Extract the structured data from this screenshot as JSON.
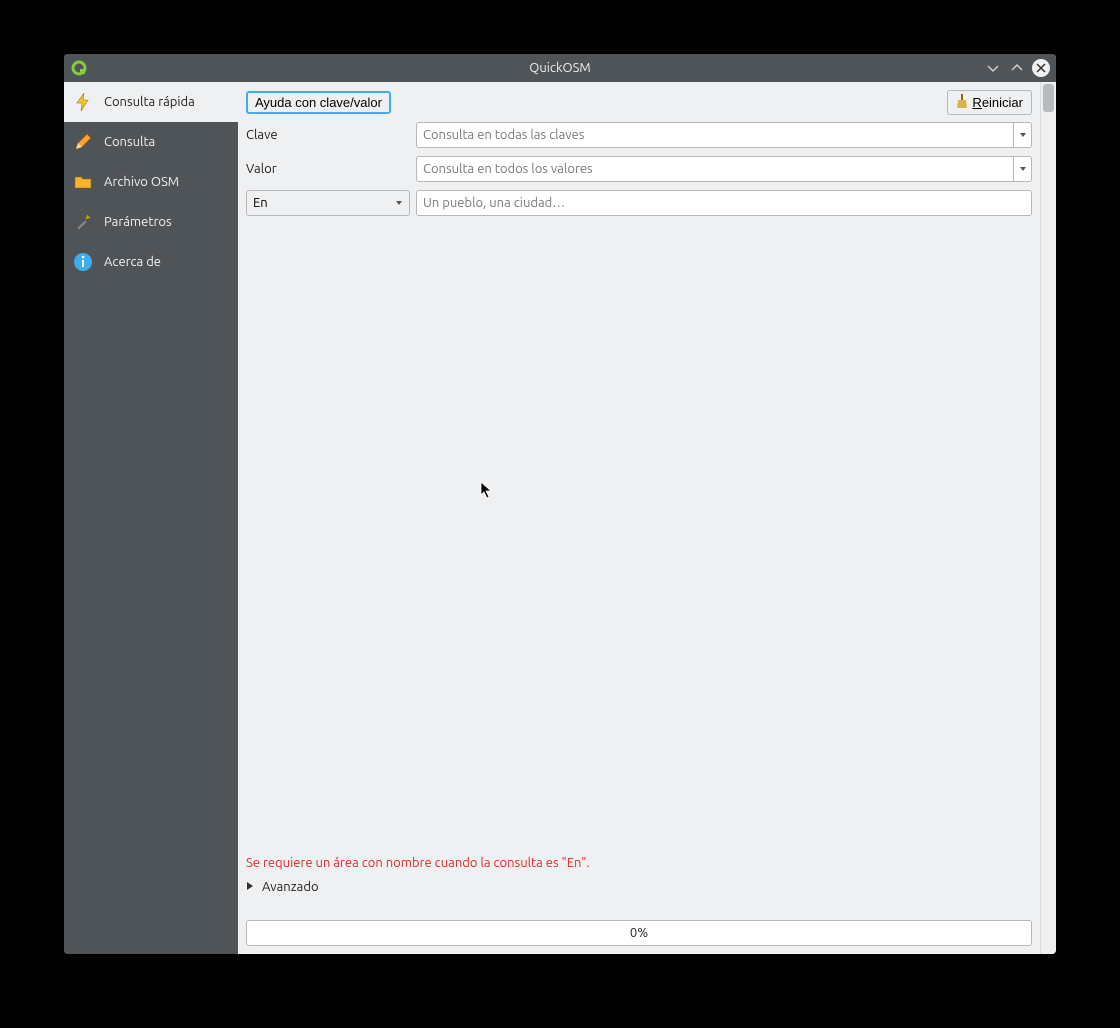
{
  "window": {
    "title": "QuickOSM"
  },
  "sidebar": {
    "items": [
      {
        "label": "Consulta rápida"
      },
      {
        "label": "Consulta"
      },
      {
        "label": "Archivo OSM"
      },
      {
        "label": "Parámetros"
      },
      {
        "label": "Acerca de"
      }
    ]
  },
  "toolbar": {
    "help_label": "Ayuda con clave/valor",
    "reset_label": "Reiniciar"
  },
  "form": {
    "key_label": "Clave",
    "key_placeholder": "Consulta en todas las claves",
    "value_label": "Valor",
    "value_placeholder": "Consulta en todos los valores",
    "scope_value": "En",
    "place_placeholder": "Un pueblo, una ciudad…"
  },
  "error": {
    "message": "Se requiere un área con nombre cuando la consulta es \"En\"."
  },
  "advanced": {
    "label": "Avanzado"
  },
  "progress": {
    "text": "0%"
  }
}
